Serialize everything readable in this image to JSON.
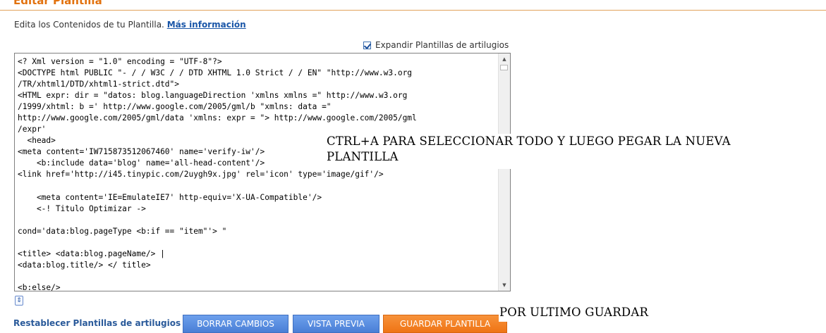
{
  "header": {
    "title": "Editar Plantilla",
    "description": "Edita los Contenidos de tu Plantilla.",
    "more_info_link": "Más información"
  },
  "expand_widgets": {
    "label": "Expandir Plantillas de artilugios",
    "checked": true
  },
  "editor": {
    "content": "<? Xml version = \"1.0\" encoding = \"UTF-8\"?>\n<DOCTYPE html PUBLIC \"- / / W3C / / DTD XHTML 1.0 Strict / / EN\" \"http://www.w3.org\n/TR/xhtml1/DTD/xhtml1-strict.dtd\">\n<HTML expr: dir = \"datos: blog.languageDirection 'xmlns xmlns =\" http://www.w3.org\n/1999/xhtml: b =' http://www.google.com/2005/gml/b \"xmlns: data =\"\nhttp://www.google.com/2005/gml/data 'xmlns: expr = \"> http://www.google.com/2005/gml\n/expr'\n  <head>\n<meta content='IW715873512067460' name='verify-iw'/>\n    <b:include data='blog' name='all-head-content'/>\n<link href='http://i45.tinypic.com/2uygh9x.jpg' rel='icon' type='image/gif'/>\n\n    <meta content='IE=EmulateIE7' http-equiv='X-UA-Compatible'/>\n    <-! Titulo Optimizar ->\n\ncond='data:blog.pageType <b:if == \"item\"'> \"\n\n<title> <data:blog.pageName/> |\n<data:blog.title/> </ title>\n\n<b:else/>"
  },
  "footer": {
    "restore_link": "Restablecer Plantillas de artilugios de",
    "clear_button": "BORRAR CAMBIOS",
    "preview_button": "VISTA PREVIA",
    "save_button": "GUARDAR PLANTILLA"
  },
  "annotations": {
    "select_all_line1": "CTRL+A  PARA SELECCIONAR TODO Y LUEGO PEGAR LA NUEVA",
    "select_all_line2": "PLANTILLA",
    "save_hint": "POR ULTIMO GUARDAR"
  },
  "colors": {
    "title": "#e2720f",
    "link": "#1a56a8",
    "button_blue": "#4a7fd6",
    "button_orange": "#ef7415"
  },
  "icons": {
    "checkbox": "checkmark-icon",
    "resize": "expand-editor-icon",
    "scroll_up": "arrow-up-icon",
    "scroll_down": "arrow-down-icon"
  }
}
